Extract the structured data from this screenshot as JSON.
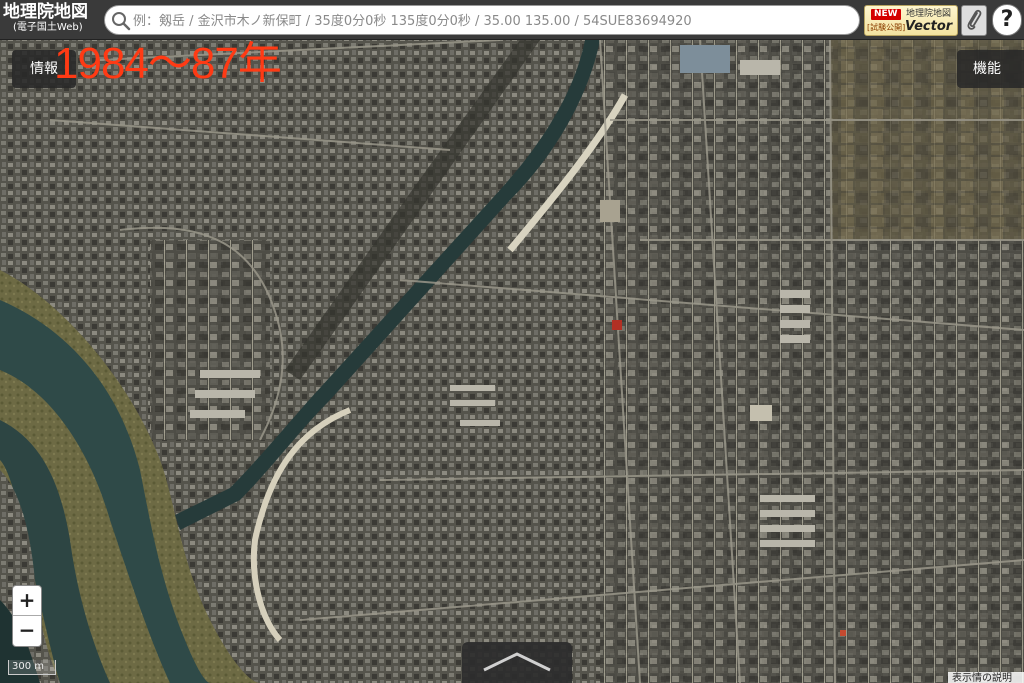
{
  "app": {
    "logo_title": "地理院地図",
    "logo_subtitle": "(電子国土Web)"
  },
  "search": {
    "placeholder": "例：剱岳 / 金沢市木ノ新保町 / 35度0分0秒 135度0分0秒 / 35.00 135.00 / 54SUE83694920",
    "icon": "search-icon"
  },
  "vector_button": {
    "new_badge": "NEW",
    "title": "地理院地図",
    "trial": "[試験公開]",
    "label": "Vector"
  },
  "clip_button": {
    "icon": "paperclip-icon"
  },
  "help_button": {
    "label": "?"
  },
  "info_button": {
    "label": "情報"
  },
  "function_button": {
    "label": "機能"
  },
  "overlay": {
    "year_label": "1984〜87年",
    "year_color": "#ff3a14"
  },
  "zoom": {
    "in_label": "+",
    "out_label": "−"
  },
  "scale_bar": {
    "label": "300 m"
  },
  "bottom_tab": {
    "icon": "chevron-up-icon"
  },
  "footer": {
    "text": "表示情の説明"
  },
  "colors": {
    "toolbar_bg": "#3a3a3a",
    "panel_bg": "#282828",
    "river": "#2f4a48",
    "urban_base": "#5a5a52"
  }
}
